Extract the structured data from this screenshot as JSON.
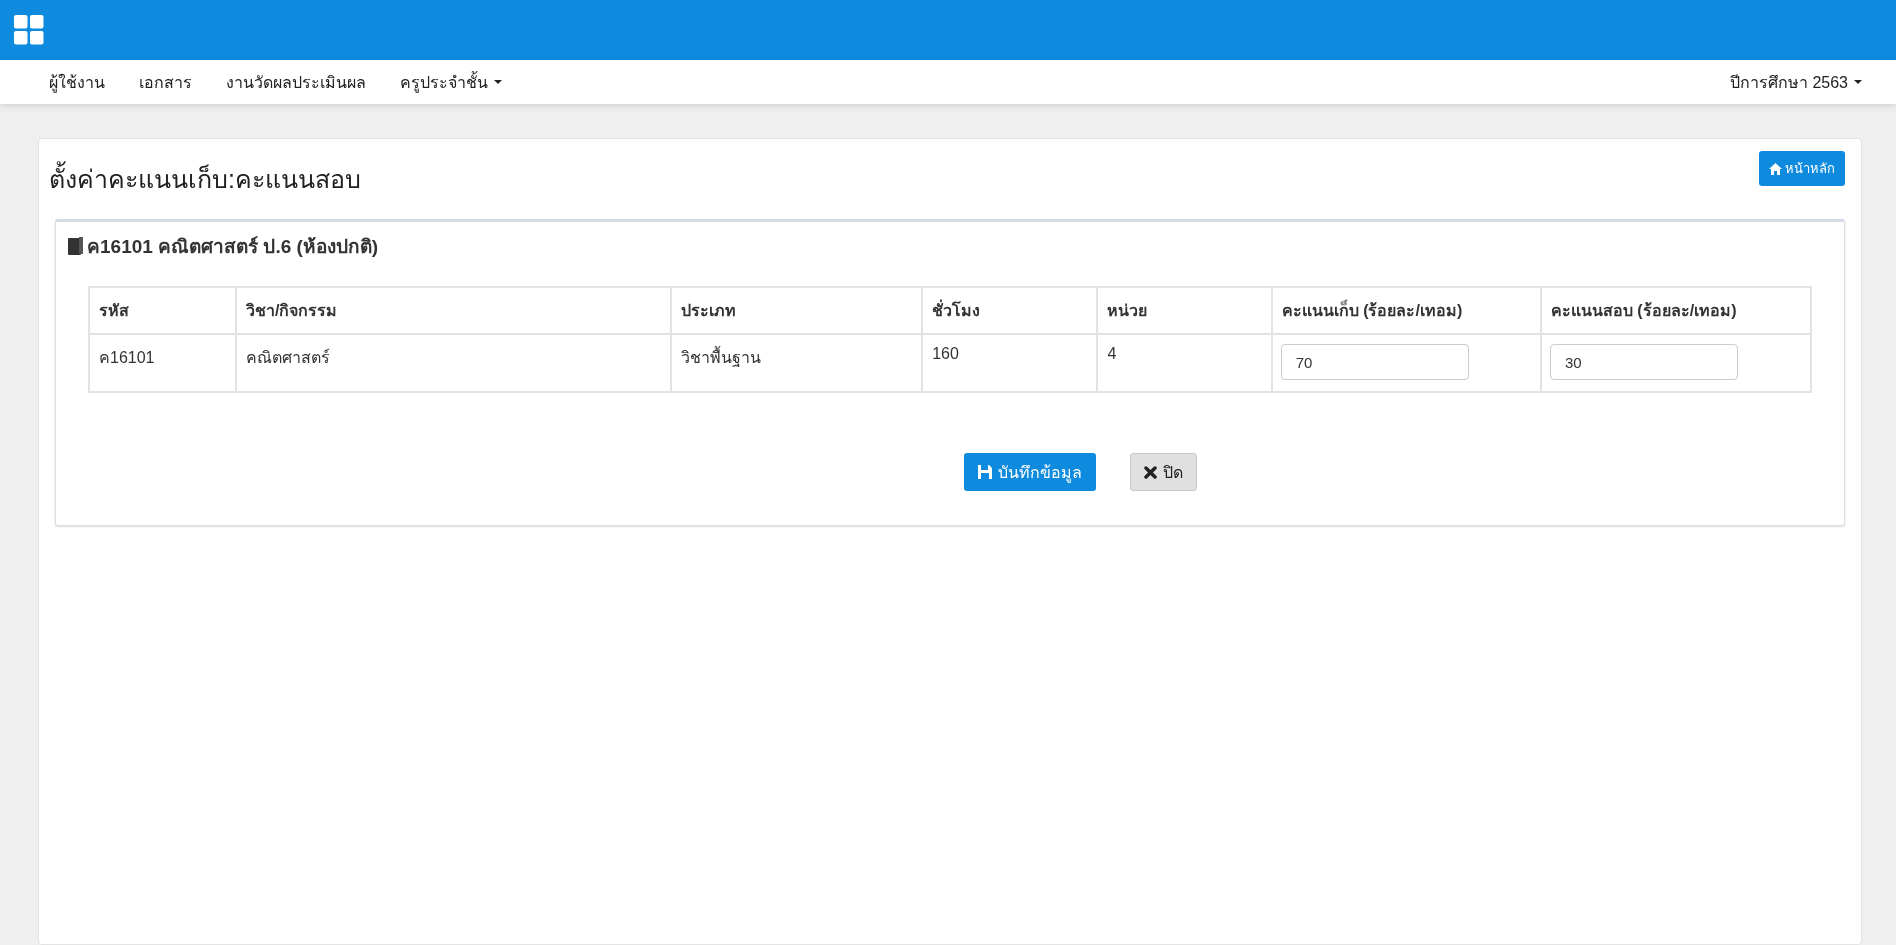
{
  "nav": {
    "items": [
      {
        "label": "ผู้ใช้งาน",
        "dropdown": false
      },
      {
        "label": "เอกสาร",
        "dropdown": false
      },
      {
        "label": "งานวัดผลประเมินผล",
        "dropdown": false
      },
      {
        "label": "ครูประจำชั้น",
        "dropdown": true
      }
    ],
    "year": "ปีการศึกษา 2563"
  },
  "page": {
    "title": "ตั้งค่าคะแนนเก็บ:คะแนนสอบ",
    "home_button": "หน้าหลัก"
  },
  "panel": {
    "heading": "ค16101 คณิตศาสตร์ ป.6 (ห้องปกติ)",
    "table": {
      "columns": [
        "รหัส",
        "วิชา/กิจกรรม",
        "ประเภท",
        "ชั่วโมง",
        "หน่วย",
        "คะแนนเก็บ (ร้อยละ/เทอม)",
        "คะแนนสอบ (ร้อยละ/เทอม)"
      ],
      "rows": [
        {
          "cells": [
            {
              "kind": "text",
              "value": "ค16101"
            },
            {
              "kind": "text",
              "value": "คณิตศาสตร์"
            },
            {
              "kind": "text",
              "value": "วิชาพื้นฐาน"
            },
            {
              "kind": "text",
              "value": "160"
            },
            {
              "kind": "text",
              "value": "4"
            },
            {
              "kind": "input",
              "value": "70"
            },
            {
              "kind": "input",
              "value": "30"
            }
          ]
        }
      ]
    },
    "save_button": "บันทึกข้อมูล",
    "close_button": "ปิด"
  }
}
